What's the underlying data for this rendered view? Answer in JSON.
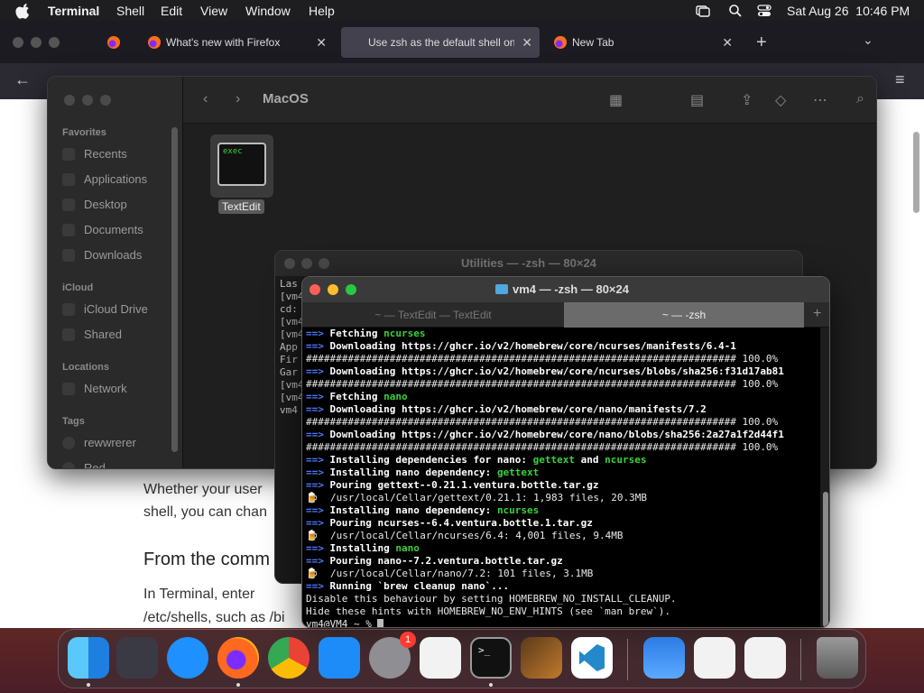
{
  "menubar": {
    "app": "Terminal",
    "items": [
      "Shell",
      "Edit",
      "View",
      "Window",
      "Help"
    ],
    "clock": "Sat Aug 26  10:46 PM"
  },
  "firefox": {
    "tabs": [
      {
        "label": "What's new with Firefox"
      },
      {
        "label": "Use zsh as the default shell on y"
      },
      {
        "label": "New Tab"
      }
    ],
    "page": {
      "line1": "Whether your user",
      "line2": "shell, you can chan",
      "heading": "From the comm",
      "line3": "In Terminal, enter",
      "line4": "/etc/shells, such as /bi"
    }
  },
  "finder": {
    "title": "MacOS",
    "sidebar": {
      "favorites_head": "Favorites",
      "favorites": [
        "Recents",
        "Applications",
        "Desktop",
        "Documents",
        "Downloads"
      ],
      "icloud_head": "iCloud",
      "icloud": [
        "iCloud Drive",
        "Shared"
      ],
      "locations_head": "Locations",
      "locations": [
        "Network"
      ],
      "tags_head": "Tags",
      "tags": [
        "rewwrerer",
        "Red"
      ]
    },
    "file": {
      "name": "TextEdit",
      "badge": "exec"
    }
  },
  "terminal_back": {
    "title": "Utilities — -zsh — 80×24",
    "lines": [
      "Las",
      "[vm4",
      "cd:",
      "[vm4",
      "[vm4",
      "App",
      "Fir",
      "Gar",
      "[vm4",
      "[vm4",
      "vm4"
    ]
  },
  "terminal_front": {
    "title": "vm4 — -zsh — 80×24",
    "tabs": [
      "~ — TextEdit — TextEdit",
      "~ — -zsh"
    ],
    "lines": [
      {
        "arrow": "==>",
        "text": " Fetching ",
        "hl": "ncurses",
        "bold": true
      },
      {
        "arrow": "==>",
        "text": " Downloading https://ghcr.io/v2/homebrew/core/ncurses/manifests/6.4-1",
        "bold": true
      },
      {
        "text": "######################################################################## 100.0%"
      },
      {
        "arrow": "==>",
        "text": " Downloading https://ghcr.io/v2/homebrew/core/ncurses/blobs/sha256:f31d17ab81",
        "bold": true
      },
      {
        "text": "######################################################################## 100.0%"
      },
      {
        "arrow": "==>",
        "text": " Fetching ",
        "hl": "nano",
        "bold": true
      },
      {
        "arrow": "==>",
        "text": " Downloading https://ghcr.io/v2/homebrew/core/nano/manifests/7.2",
        "bold": true
      },
      {
        "text": "######################################################################## 100.0%"
      },
      {
        "arrow": "==>",
        "text": " Downloading https://ghcr.io/v2/homebrew/core/nano/blobs/sha256:2a27a1f2d44f1",
        "bold": true
      },
      {
        "text": "######################################################################## 100.0%"
      },
      {
        "arrow": "==>",
        "text": " Installing dependencies for nano: ",
        "hl": "gettext",
        "mid": " and ",
        "hl2": "ncurses",
        "bold": true
      },
      {
        "arrow": "==>",
        "text": " Installing nano dependency: ",
        "hl": "gettext",
        "bold": true
      },
      {
        "arrow": "==>",
        "text": " Pouring gettext--0.21.1.ventura.bottle.tar.gz",
        "bold": true
      },
      {
        "beer": "🍺",
        "text": "  /usr/local/Cellar/gettext/0.21.1: 1,983 files, 20.3MB"
      },
      {
        "arrow": "==>",
        "text": " Installing nano dependency: ",
        "hl": "ncurses",
        "bold": true
      },
      {
        "arrow": "==>",
        "text": " Pouring ncurses--6.4.ventura.bottle.1.tar.gz",
        "bold": true
      },
      {
        "beer": "🍺",
        "text": "  /usr/local/Cellar/ncurses/6.4: 4,001 files, 9.4MB"
      },
      {
        "arrow": "==>",
        "text": " Installing ",
        "hl": "nano",
        "bold": true
      },
      {
        "arrow": "==>",
        "text": " Pouring nano--7.2.ventura.bottle.tar.gz",
        "bold": true
      },
      {
        "beer": "🍺",
        "text": "  /usr/local/Cellar/nano/7.2: 101 files, 3.1MB"
      },
      {
        "arrow": "==>",
        "text": " Running `brew cleanup nano`...",
        "bold": true
      },
      {
        "text": "Disable this behaviour by setting HOMEBREW_NO_INSTALL_CLEANUP."
      },
      {
        "text": "Hide these hints with HOMEBREW_NO_ENV_HINTS (see `man brew`)."
      },
      {
        "text": "vm4@VM4 ~ % "
      }
    ]
  },
  "dock": {
    "badge": "1",
    "apps": [
      "finder-icon",
      "launchpad-icon",
      "safari-icon",
      "firefox-icon",
      "chrome-icon",
      "app-store-icon",
      "system-settings-icon",
      "textedit-icon",
      "terminal-icon",
      "garageband-icon",
      "vscode-icon",
      "weather-icon",
      "textedit-icon-2",
      "textedit-icon-3",
      "trash-icon"
    ]
  }
}
